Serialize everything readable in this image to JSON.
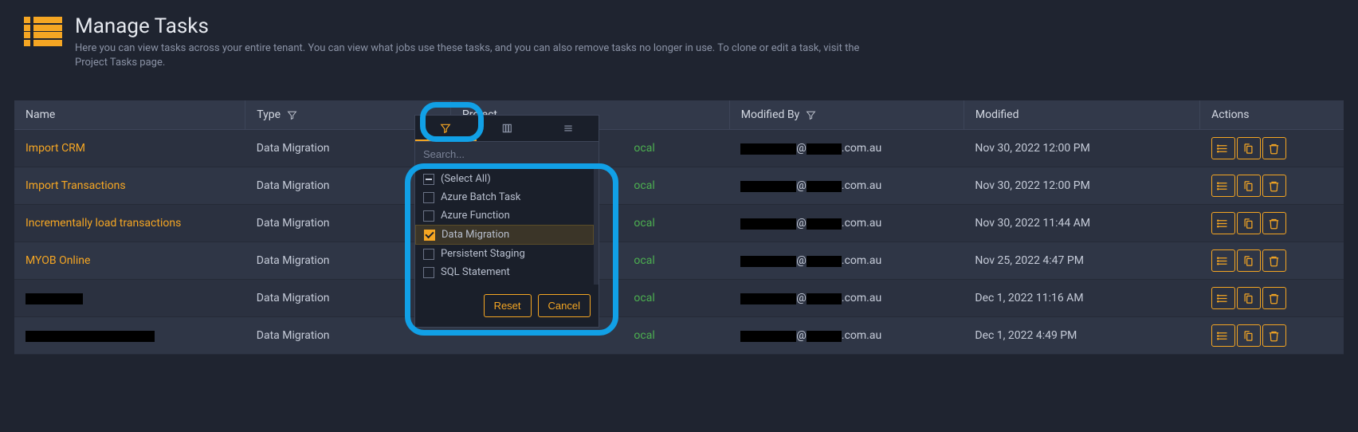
{
  "header": {
    "title": "Manage Tasks",
    "subtitle": "Here you can view tasks across your entire tenant. You can view what jobs use these tasks, and you can also remove tasks no longer in use. To clone or edit a task, visit the Project Tasks page."
  },
  "columns": {
    "name": "Name",
    "type": "Type",
    "project": "Project",
    "modified_by": "Modified By",
    "modified": "Modified",
    "actions": "Actions"
  },
  "rows": [
    {
      "name": "Import CRM",
      "name_redacted": false,
      "type": "Data Migration",
      "project_suffix": "ocal",
      "modby_mid": "@",
      "modby_suffix": ".com.au",
      "modified": "Nov 30, 2022 12:00 PM"
    },
    {
      "name": "Import Transactions",
      "name_redacted": false,
      "type": "Data Migration",
      "project_suffix": "ocal",
      "modby_mid": "@",
      "modby_suffix": ".com.au",
      "modified": "Nov 30, 2022 12:00 PM"
    },
    {
      "name": "Incrementally load transactions",
      "name_redacted": false,
      "type": "Data Migration",
      "project_suffix": "ocal",
      "modby_mid": "@",
      "modby_suffix": ".com.au",
      "modified": "Nov 30, 2022 11:44 AM"
    },
    {
      "name": "MYOB Online",
      "name_redacted": false,
      "type": "Data Migration",
      "project_suffix": "ocal",
      "modby_mid": "@",
      "modby_suffix": ".com.au",
      "modified": "Nov 25, 2022 4:47 PM"
    },
    {
      "name": "",
      "name_redacted": true,
      "redact_width": 72,
      "type": "Data Migration",
      "project_suffix": "ocal",
      "modby_mid": "@",
      "modby_suffix": ".com.au",
      "modified": "Dec 1, 2022 11:16 AM"
    },
    {
      "name": "",
      "name_redacted": true,
      "redact_width": 162,
      "type": "Data Migration",
      "project_suffix": "ocal",
      "modby_mid": "@",
      "modby_suffix": ".com.au",
      "modified": "Dec 1, 2022 4:49 PM"
    }
  ],
  "filter_popup": {
    "search_placeholder": "Search...",
    "options": [
      {
        "label": "(Select All)",
        "state": "indeterminate"
      },
      {
        "label": "Azure Batch Task",
        "state": "unchecked"
      },
      {
        "label": "Azure Function",
        "state": "unchecked"
      },
      {
        "label": "Data Migration",
        "state": "checked"
      },
      {
        "label": "Persistent Staging",
        "state": "unchecked"
      },
      {
        "label": "SQL Statement",
        "state": "unchecked"
      }
    ],
    "reset_label": "Reset",
    "cancel_label": "Cancel"
  }
}
